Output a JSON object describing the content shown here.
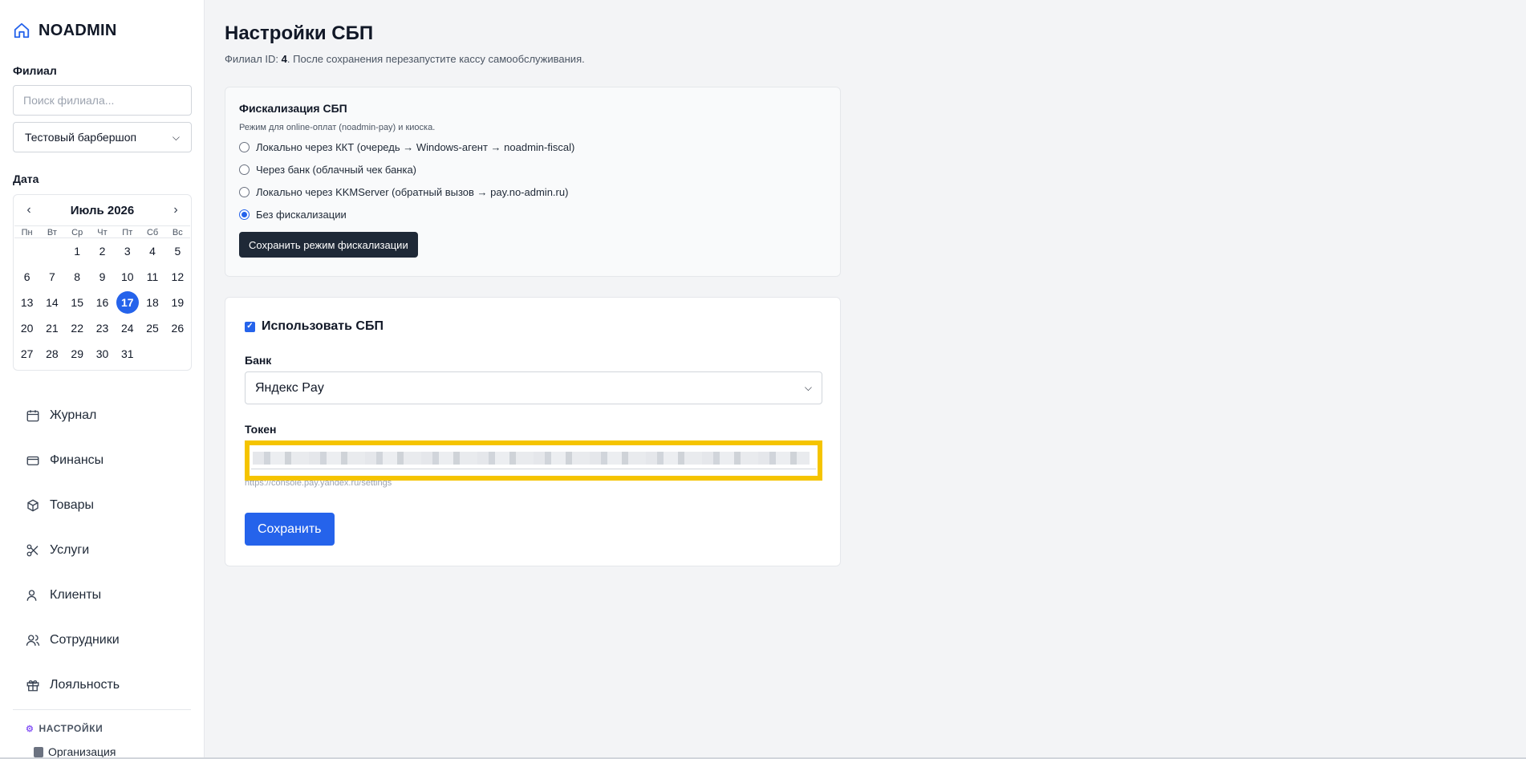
{
  "sidebar": {
    "brand": "NOADMIN",
    "branch_label": "Филиал",
    "search_placeholder": "Поиск филиала...",
    "branch_selected": "Тестовый барбершоп",
    "date_label": "Дата",
    "calendar": {
      "month": "Июль 2026",
      "weekdays": [
        "Пн",
        "Вт",
        "Ср",
        "Чт",
        "Пт",
        "Сб",
        "Вс"
      ],
      "selected_day": 17
    },
    "nav": [
      {
        "label": "Журнал",
        "icon": "calendar-icon"
      },
      {
        "label": "Финансы",
        "icon": "credit-card-icon"
      },
      {
        "label": "Товары",
        "icon": "box-icon"
      },
      {
        "label": "Услуги",
        "icon": "scissors-icon"
      },
      {
        "label": "Клиенты",
        "icon": "user-icon"
      },
      {
        "label": "Сотрудники",
        "icon": "users-icon"
      },
      {
        "label": "Лояльность",
        "icon": "gift-icon"
      }
    ],
    "settings_label": "НАСТРОЙКИ",
    "settings_items": [
      {
        "label": "Организация"
      }
    ]
  },
  "page": {
    "title": "Настройки СБП",
    "sub_prefix": "Филиал ID: ",
    "branch_id": "4",
    "sub_suffix": ". После сохранения перезапустите кассу самообслуживания."
  },
  "fiscal": {
    "title": "Фискализация СБП",
    "desc": "Режим для online-оплат (noadmin-pay) и киоска.",
    "options": [
      {
        "label": "Локально через ККТ (очередь → Windows-агент → noadmin-fiscal)",
        "checked": false
      },
      {
        "label": "Через банк (облачный чек банка)",
        "checked": false
      },
      {
        "label": "Локально через KKMServer (обратный вызов → pay.no-admin.ru)",
        "checked": false
      },
      {
        "label": "Без фискализации",
        "checked": true
      }
    ],
    "save_label": "Сохранить режим фискализации"
  },
  "sbp": {
    "use_label": "Использовать СБП",
    "use_checked": true,
    "bank_label": "Банк",
    "bank_selected": "Яндекс Pay",
    "token_label": "Токен",
    "token_hint": "https://console.pay.yandex.ru/settings",
    "save_label": "Сохранить"
  },
  "colors": {
    "accent": "#2563eb",
    "dark_button": "#1f2937",
    "highlight": "#f5c400"
  }
}
